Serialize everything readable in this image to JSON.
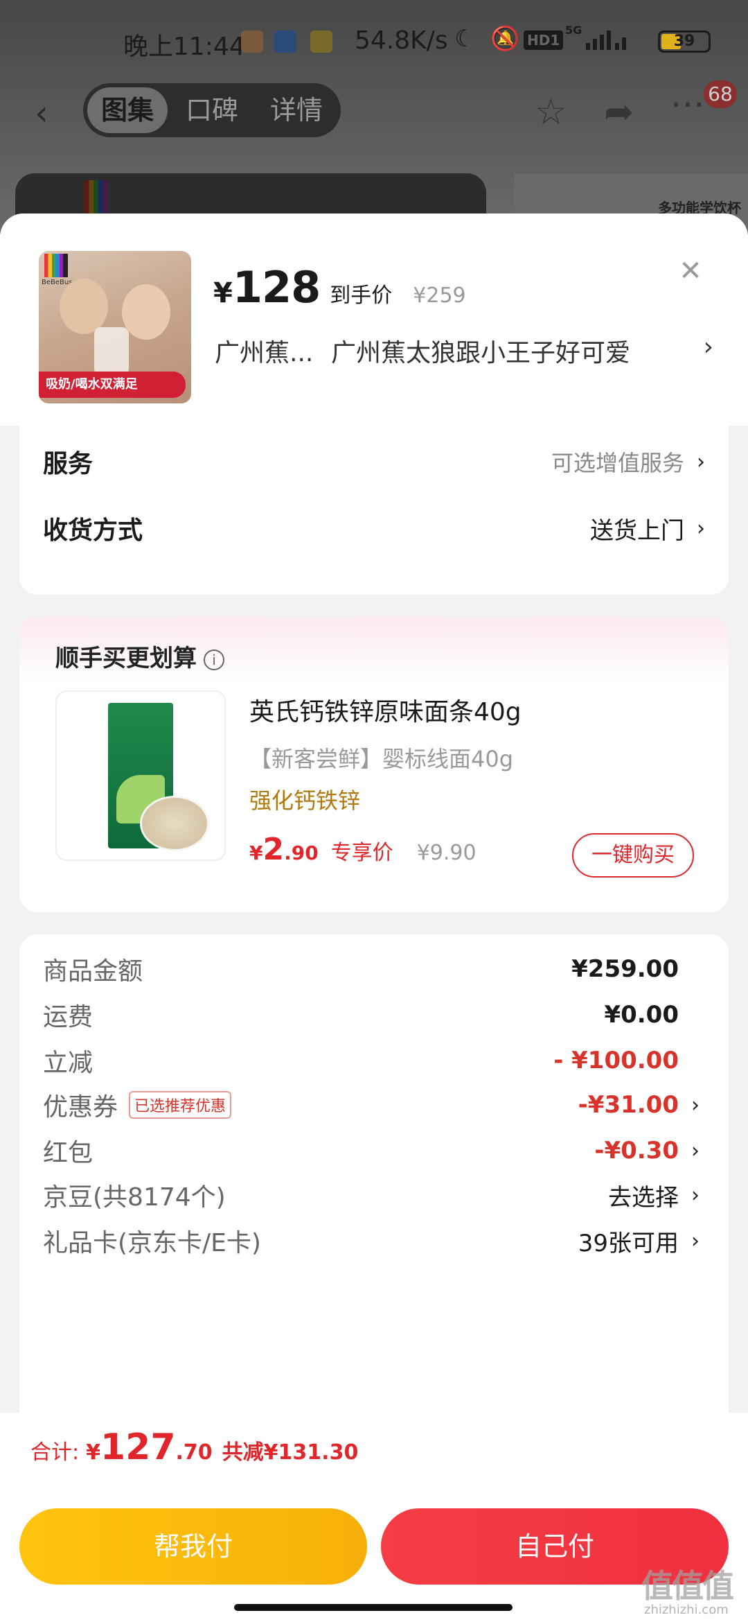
{
  "status_bar": {
    "time": "晚上11:44",
    "net_speed": "54.8K/s",
    "network": "5G",
    "hd": "HD1",
    "battery": "39"
  },
  "nav": {
    "tabs": [
      {
        "label": "图集",
        "active": true
      },
      {
        "label": "口碑",
        "active": false
      },
      {
        "label": "详情",
        "active": false
      }
    ],
    "badge": "68",
    "bg_caption": "多功能学饮杯"
  },
  "product": {
    "currency": "¥",
    "price": "128",
    "price_tag": "到手价",
    "original_price": "¥259",
    "thumb_ribbon": "吸奶/喝水双满足",
    "thumb_brand": "BeBeBus",
    "address_short": "广州蕉...",
    "address_full": "广州蕉太狼跟小王子好可爱"
  },
  "options": {
    "service_label": "服务",
    "service_value": "可选增值服务",
    "delivery_label": "收货方式",
    "delivery_value": "送货上门"
  },
  "upsell": {
    "title": "顺手买更划算",
    "item_name": "英氏钙铁锌原味面条40g",
    "item_sub": "【新客尝鲜】婴标线面40g",
    "item_feature": "强化钙铁锌",
    "price_currency": "¥",
    "price_int": "2",
    "price_dec": ".90",
    "exclusive_label": "专享价",
    "original_price": "¥9.90",
    "buy_button": "一键购买"
  },
  "fees": {
    "goods_label": "商品金额",
    "goods_value": "¥259.00",
    "shipping_label": "运费",
    "shipping_value": "¥0.00",
    "discount_label": "立减",
    "discount_value": "- ¥100.00",
    "coupon_label": "优惠券",
    "coupon_tag": "已选推荐优惠",
    "coupon_value": "-¥31.00",
    "redpacket_label": "红包",
    "redpacket_value": "-¥0.30",
    "jingdou_label": "京豆(共8174个)",
    "jingdou_value": "去选择",
    "giftcard_label": "礼品卡(京东卡/E卡)",
    "giftcard_value": "39张可用"
  },
  "footer": {
    "total_label": "合计:",
    "total_currency": "¥",
    "total_int": "127",
    "total_dec": ".70",
    "total_saved": "共减¥131.30",
    "friend_pay": "帮我付",
    "self_pay": "自己付"
  },
  "watermark": {
    "mark": "值值值",
    "url": "zhizhizhi.com"
  },
  "colors": {
    "accent_red": "#e0262a",
    "pay_yellow": "#ffc40e",
    "pay_red": "#f53d44"
  }
}
